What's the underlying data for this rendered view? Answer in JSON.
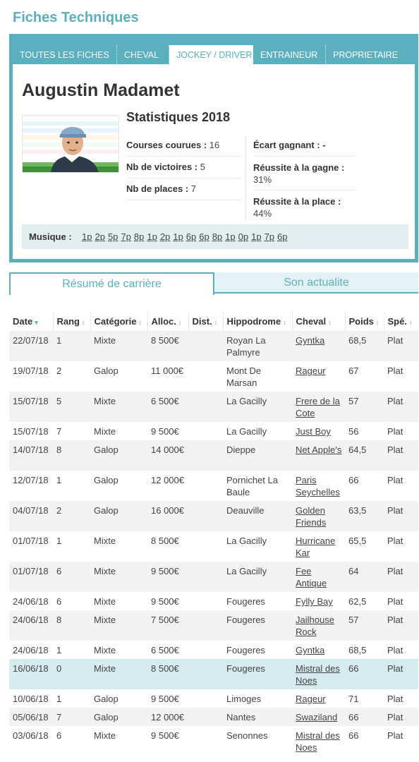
{
  "page_title": "Fiches Techniques",
  "tabs": [
    "TOUTES LES FICHES",
    "CHEVAL",
    "JOCKEY / DRIVER",
    "ENTRAINEUR",
    "PROPRIETAIRE"
  ],
  "profile": {
    "name": "Augustin Madamet",
    "avatar_icon": "jockey-avatar-icon"
  },
  "stats": {
    "title": "Statistiques 2018",
    "courses_label": "Courses courues :",
    "courses_value": "16",
    "victoires_label": "Nb de victoires :",
    "victoires_value": "5",
    "places_label": "Nb de places :",
    "places_value": "7",
    "ecart_label": "Écart gagnant :",
    "ecart_value": "-",
    "reussite_gagne_label": "Réussite à la gagne :",
    "reussite_gagne_value": "31%",
    "reussite_place_label": "Réussite à la place :",
    "reussite_place_value": "44%"
  },
  "musique": {
    "label": "Musique :",
    "values": [
      "1p",
      "2p",
      "5p",
      "7p",
      "8p",
      "1p",
      "2p",
      "1p",
      "6p",
      "6p",
      "8p",
      "1p",
      "0p",
      "1p",
      "7p",
      "6p"
    ]
  },
  "subtabs": {
    "resume": "Résumé de carrière",
    "actualite": "Son actualite"
  },
  "table": {
    "headers": [
      "Date",
      "Rang",
      "Catégorie",
      "Alloc.",
      "Dist.",
      "Hippodrome",
      "Cheval",
      "Poids",
      "Spé."
    ],
    "rows": [
      [
        "22/07/18",
        "1",
        "Mixte",
        "8 500€",
        "",
        "Royan La Palmyre",
        "Gyntka",
        "68,5",
        "Plat"
      ],
      [
        "19/07/18",
        "2",
        "Galop",
        "11 000€",
        "",
        "Mont De Marsan",
        "Rageur",
        "67",
        "Plat"
      ],
      [
        "15/07/18",
        "5",
        "Mixte",
        "6 500€",
        "",
        "La Gacilly",
        "Frere de la Cote",
        "57",
        "Plat"
      ],
      [
        "15/07/18",
        "7",
        "Mixte",
        "9 500€",
        "",
        "La Gacilly",
        "Just Boy",
        "56",
        "Plat"
      ],
      [
        "14/07/18",
        "8",
        "Galop",
        "14 000€",
        "",
        "Dieppe",
        "Net Apple's",
        "64,5",
        "Plat"
      ],
      [
        "12/07/18",
        "1",
        "Galop",
        "12 000€",
        "",
        "Pornichet La Baule",
        "Paris Seychelles",
        "66",
        "Plat"
      ],
      [
        "04/07/18",
        "2",
        "Galop",
        "16 000€",
        "",
        "Deauville",
        "Golden Friends",
        "63,5",
        "Plat"
      ],
      [
        "01/07/18",
        "1",
        "Mixte",
        "8 500€",
        "",
        "La Gacilly",
        "Hurricane Kar",
        "65,5",
        "Plat"
      ],
      [
        "01/07/18",
        "6",
        "Mixte",
        "9 500€",
        "",
        "La Gacilly",
        "Fee Antique",
        "64",
        "Plat"
      ],
      [
        "24/06/18",
        "6",
        "Mixte",
        "9 500€",
        "",
        "Fougeres",
        "Fylly Bay",
        "62,5",
        "Plat"
      ],
      [
        "24/06/18",
        "8",
        "Mixte",
        "7 500€",
        "",
        "Fougeres",
        "Jailhouse Rock",
        "57",
        "Plat"
      ],
      [
        "24/06/18",
        "1",
        "Mixte",
        "6 500€",
        "",
        "Fougeres",
        "Gyntka",
        "68,5",
        "Plat"
      ],
      [
        "16/06/18",
        "0",
        "Mixte",
        "8 500€",
        "",
        "Fougeres",
        "Mistral des Noes",
        "66",
        "Plat"
      ],
      [
        "10/06/18",
        "1",
        "Galop",
        "9 500€",
        "",
        "Limoges",
        "Rageur",
        "71",
        "Plat"
      ],
      [
        "05/06/18",
        "7",
        "Galop",
        "12 000€",
        "",
        "Nantes",
        "Swaziland",
        "66",
        "Plat"
      ],
      [
        "03/06/18",
        "6",
        "Mixte",
        "9 500€",
        "",
        "Senonnes",
        "Mistral des Noes",
        "66",
        "Plat"
      ]
    ],
    "highlight_row_index": 12
  },
  "colors": {
    "accent": "#5ab0bd",
    "highlight": "#d4ecef",
    "row_alt": "#f3f3f3"
  }
}
